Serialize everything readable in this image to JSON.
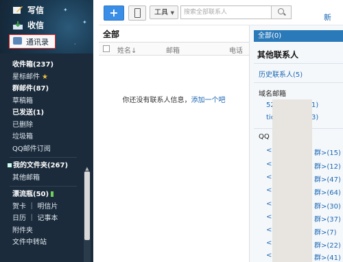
{
  "sidebar": {
    "quick": {
      "write": "写信",
      "receive": "收信",
      "contacts": "通讯录"
    },
    "items": [
      {
        "label": "收件箱(237)",
        "bold": true
      },
      {
        "label": "星标邮件",
        "bold": false
      },
      {
        "label": "群邮件(87)",
        "bold": true
      },
      {
        "label": "草稿箱",
        "bold": false
      },
      {
        "label": "已发送(1)",
        "bold": true
      },
      {
        "label": "已删除",
        "bold": false
      },
      {
        "label": "垃圾箱",
        "bold": false
      },
      {
        "label": "QQ邮件订阅",
        "bold": false
      }
    ],
    "folders": {
      "my_folders": "我的文件夹(267)",
      "other": "其他邮箱"
    },
    "extras": {
      "drift": "漂流瓶(50)",
      "card": "贺卡 ｜ 明信片",
      "calendar": "日历 ｜ 记事本",
      "attach": "附件夹",
      "transfer": "文件中转站"
    }
  },
  "toolbar": {
    "add": "+",
    "tools": "工具",
    "search_placeholder": "搜索全部联系人",
    "new_label": "新"
  },
  "list": {
    "title": "全部",
    "col_name": "姓名↓",
    "col_email": "邮箱",
    "col_phone": "电话",
    "empty_text": "你还没有联系人信息，",
    "empty_link": "添加一个吧"
  },
  "groups": {
    "all": "全部(0)",
    "other_title": "其他联系人",
    "history": "历史联系人(5)",
    "domain_title": "域名邮箱",
    "domain_rows": [
      "52",
      "1)",
      "tic",
      "3)"
    ],
    "qq_title": "QQ",
    "qq_rows": [
      {
        "left": "<",
        "right": "群>(15)"
      },
      {
        "left": "<",
        "right": "群>(12)"
      },
      {
        "left": "<",
        "right": "群>(47)"
      },
      {
        "left": "<",
        "right": "群>(64)"
      },
      {
        "left": "<",
        "right": "群>(30)"
      },
      {
        "left": "<",
        "right": "群>(37)"
      },
      {
        "left": "<",
        "right": "群>(7)"
      },
      {
        "left": "<",
        "right": "群>(22)"
      },
      {
        "left": "<",
        "right": "群>(41)"
      }
    ]
  },
  "colors": {
    "sidebar": "#1b2b3b",
    "accent": "#2a79b9",
    "link": "#1a66b3"
  },
  "icons": [
    "write-icon",
    "inbox-icon",
    "contacts-icon",
    "star-icon",
    "bottle-icon",
    "phone-icon",
    "search-icon"
  ]
}
